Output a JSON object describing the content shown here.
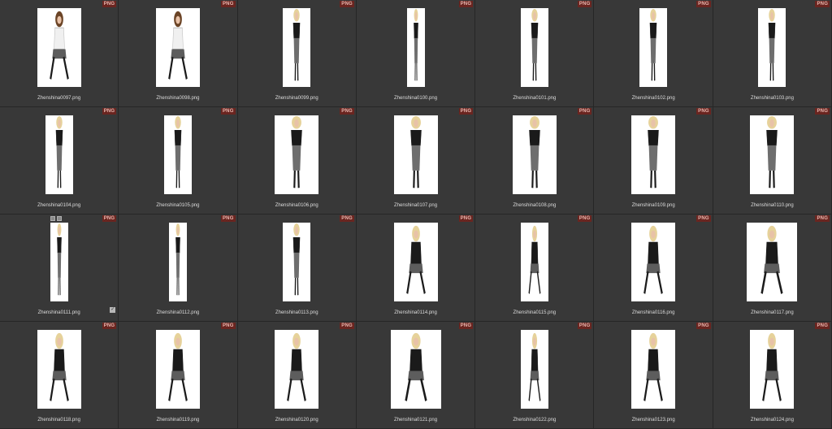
{
  "badge_label": "PNG",
  "colors": {
    "cell_bg": "#383838",
    "badge_bg": "#6a2520",
    "badge_text": "#e8b8b0",
    "filename_text": "#dcdcdc"
  },
  "thumbnails": [
    {
      "filename": "Zhenshina0097.png",
      "pose": "sitting",
      "hair": "brunette",
      "top": "white",
      "width": "wide"
    },
    {
      "filename": "Zhenshina0098.png",
      "pose": "sitting",
      "hair": "brunette",
      "top": "white",
      "width": "wide"
    },
    {
      "filename": "Zhenshina0099.png",
      "pose": "standing",
      "hair": "blonde",
      "top": "black",
      "width": "medium"
    },
    {
      "filename": "Zhenshina0100.png",
      "pose": "standing",
      "hair": "blonde",
      "top": "black",
      "width": "narrow"
    },
    {
      "filename": "Zhenshina0101.png",
      "pose": "standing",
      "hair": "blonde",
      "top": "black",
      "width": "medium"
    },
    {
      "filename": "Zhenshina0102.png",
      "pose": "standing",
      "hair": "blonde",
      "top": "black",
      "width": "medium"
    },
    {
      "filename": "Zhenshina0103.png",
      "pose": "standing",
      "hair": "blonde",
      "top": "black",
      "width": "medium"
    },
    {
      "filename": "Zhenshina0104.png",
      "pose": "standing",
      "hair": "blonde",
      "top": "black",
      "width": "medium"
    },
    {
      "filename": "Zhenshina0105.png",
      "pose": "standing",
      "hair": "blonde",
      "top": "black",
      "width": "medium"
    },
    {
      "filename": "Zhenshina0106.png",
      "pose": "standing",
      "hair": "blonde",
      "top": "black",
      "width": "wide"
    },
    {
      "filename": "Zhenshina0107.png",
      "pose": "standing",
      "hair": "blonde",
      "top": "black",
      "width": "wide"
    },
    {
      "filename": "Zhenshina0108.png",
      "pose": "standing",
      "hair": "blonde",
      "top": "black",
      "width": "wide"
    },
    {
      "filename": "Zhenshina0109.png",
      "pose": "standing",
      "hair": "blonde",
      "top": "black",
      "width": "wide"
    },
    {
      "filename": "Zhenshina0110.png",
      "pose": "standing",
      "hair": "blonde",
      "top": "black",
      "width": "wide"
    },
    {
      "filename": "Zhenshina0111.png",
      "pose": "standing",
      "hair": "blonde",
      "top": "black",
      "width": "narrow",
      "selected": true
    },
    {
      "filename": "Zhenshina0112.png",
      "pose": "standing",
      "hair": "blonde",
      "top": "black",
      "width": "narrow"
    },
    {
      "filename": "Zhenshina0113.png",
      "pose": "standing",
      "hair": "blonde",
      "top": "black",
      "width": "medium"
    },
    {
      "filename": "Zhenshina0114.png",
      "pose": "sitting",
      "hair": "blonde",
      "top": "black",
      "width": "wide"
    },
    {
      "filename": "Zhenshina0115.png",
      "pose": "sitting",
      "hair": "blonde",
      "top": "black",
      "width": "medium"
    },
    {
      "filename": "Zhenshina0116.png",
      "pose": "sitting",
      "hair": "blonde",
      "top": "black",
      "width": "wide"
    },
    {
      "filename": "Zhenshina0117.png",
      "pose": "sitting",
      "hair": "blonde",
      "top": "black",
      "width": "xwide"
    },
    {
      "filename": "Zhenshina0118.png",
      "pose": "sitting",
      "hair": "blonde",
      "top": "black",
      "width": "wide"
    },
    {
      "filename": "Zhenshina0119.png",
      "pose": "sitting",
      "hair": "blonde",
      "top": "black",
      "width": "wide"
    },
    {
      "filename": "Zhenshina0120.png",
      "pose": "sitting",
      "hair": "blonde",
      "top": "black",
      "width": "wide"
    },
    {
      "filename": "Zhenshina0121.png",
      "pose": "sitting",
      "hair": "blonde",
      "top": "black",
      "width": "xwide"
    },
    {
      "filename": "Zhenshina0122.png",
      "pose": "sitting",
      "hair": "blonde",
      "top": "black",
      "width": "medium"
    },
    {
      "filename": "Zhenshina0123.png",
      "pose": "sitting",
      "hair": "blonde",
      "top": "black",
      "width": "wide"
    },
    {
      "filename": "Zhenshina0124.png",
      "pose": "sitting",
      "hair": "blonde",
      "top": "black",
      "width": "wide"
    }
  ]
}
